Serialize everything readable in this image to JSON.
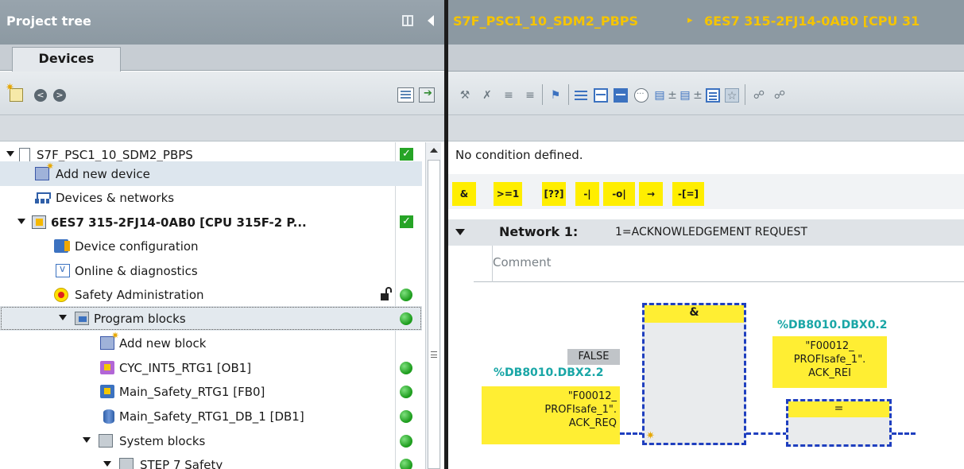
{
  "project_tree": {
    "title": "Project tree",
    "tab_devices": "Devices",
    "items": [
      {
        "label": "S7F_PSC1_10_SDM2_PBPS",
        "status": "check"
      },
      {
        "label": "Add new device"
      },
      {
        "label": "Devices & networks"
      },
      {
        "label": "6ES7 315-2FJ14-0AB0 [CPU 315F-2 P...",
        "status": "check"
      },
      {
        "label": "Device configuration"
      },
      {
        "label": "Online & diagnostics"
      },
      {
        "label": "Safety Administration",
        "status": "ok",
        "lock": true
      },
      {
        "label": "Program blocks",
        "status": "ok"
      },
      {
        "label": "Add new block"
      },
      {
        "label": "CYC_INT5_RTG1 [OB1]",
        "status": "ok"
      },
      {
        "label": "Main_Safety_RTG1 [FB0]",
        "status": "ok"
      },
      {
        "label": "Main_Safety_RTG1_DB_1 [DB1]",
        "status": "ok"
      },
      {
        "label": "System blocks",
        "status": "ok"
      },
      {
        "label": "STEP 7 Safety",
        "status": "ok"
      }
    ]
  },
  "editor": {
    "breadcrumb": [
      "S7F_PSC1_10_SDM2_PBPS",
      "6ES7 315-2FJ14-0AB0 [CPU 31"
    ],
    "breadcrumb_separator": "▸",
    "condition_text": "No condition defined.",
    "instructions": [
      "&",
      ">=1",
      "[??]",
      "-|",
      "-o|",
      "→",
      "-[=]"
    ],
    "network": {
      "title": "Network 1:",
      "description": "1=ACKNOWLEDGEMENT REQUEST",
      "comment_placeholder": "Comment"
    },
    "fbd": {
      "false_value": "FALSE",
      "input_address": "%DB8010.DBX2.2",
      "input_tag": "\"F00012_\nPROFIsafe_1\".\nACK_REQ",
      "and_label": "&",
      "output_address": "%DB8010.DBX0.2",
      "output_tag": "\"F00012_\nPROFIsafe_1\".\nACK_REI",
      "coil_label": "="
    }
  },
  "colors": {
    "title_bar": "#8c99a2",
    "accent_yellow": "#ffee00",
    "status_green": "#1e9d1e",
    "wire_blue": "#1f3fbf",
    "address_teal": "#19a6a6"
  }
}
